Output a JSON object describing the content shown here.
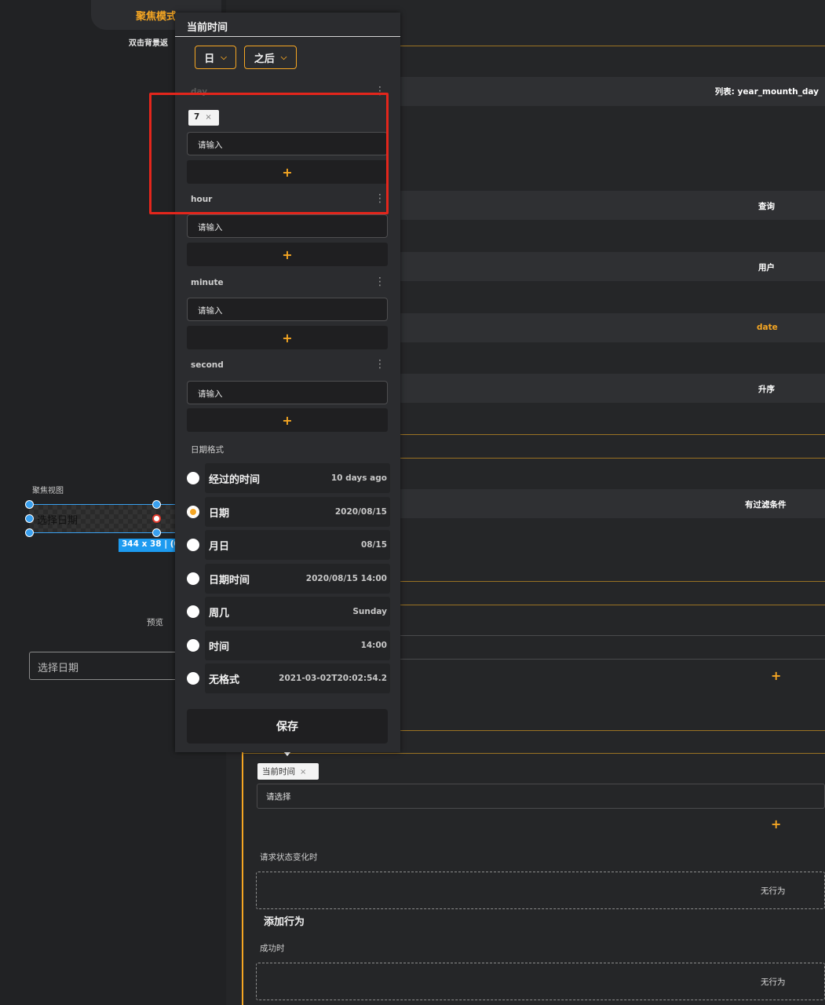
{
  "canvas": {
    "focus_mode": "聚焦模式",
    "double_click_hint": "双击背景返",
    "focus_view_label": "聚焦视图",
    "selected_text": "选择日期",
    "size_badge": "344 x 38 | (0",
    "preview_label": "预览",
    "preview_placeholder": "选择日期"
  },
  "properties": {
    "list_label": "列表: year_mounth_day",
    "rows": [
      "查询",
      "用户",
      "date",
      "升序",
      "有过滤条件"
    ],
    "tag": "当前时间",
    "tag_close": "×",
    "select_placeholder": "请选择",
    "request_state_label": "请求状态变化时",
    "no_action": "无行为",
    "add_action": "添加行为",
    "success_label": "成功时",
    "no_action_2": "无行为",
    "plus": "+"
  },
  "popup": {
    "title": "当前时间",
    "unit_dropdown": "日",
    "direction_dropdown": "之后",
    "fields": {
      "day": {
        "label": "day",
        "chip": "7",
        "placeholder": "请输入"
      },
      "hour": {
        "label": "hour",
        "placeholder": "请输入"
      },
      "minute": {
        "label": "minute",
        "placeholder": "请输入"
      },
      "second": {
        "label": "second",
        "placeholder": "请输入"
      }
    },
    "kebab": "⋮",
    "chip_close": "×",
    "add": "+",
    "chevron": "⌵",
    "date_format_label": "日期格式",
    "formats": [
      {
        "name": "经过的时间",
        "example": "10 days ago",
        "selected": false
      },
      {
        "name": "日期",
        "example": "2020/08/15",
        "selected": true
      },
      {
        "name": "月日",
        "example": "08/15",
        "selected": false
      },
      {
        "name": "日期时间",
        "example": "2020/08/15 14:00",
        "selected": false
      },
      {
        "name": "周几",
        "example": "Sunday",
        "selected": false
      },
      {
        "name": "时间",
        "example": "14:00",
        "selected": false
      },
      {
        "name": "无格式",
        "example": "2021-03-02T20:02:54.2",
        "selected": false
      }
    ],
    "save": "保存"
  },
  "colors": {
    "accent": "#f5a623",
    "highlight": "#e3261c",
    "selection": "#39a0ef"
  }
}
